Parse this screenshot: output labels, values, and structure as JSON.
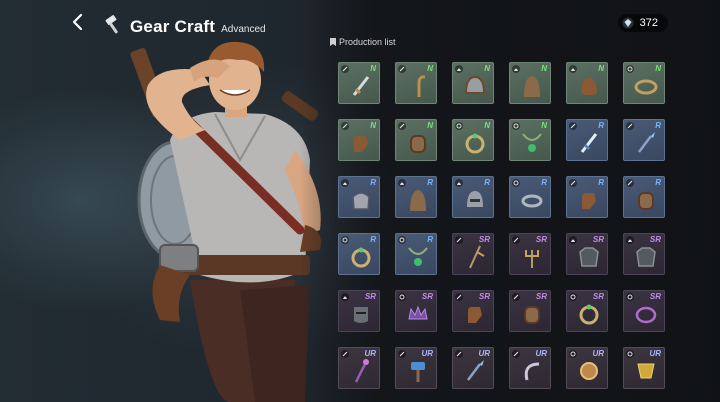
{
  "header": {
    "title": "Gear Craft",
    "subtitle": "Advanced",
    "back_icon": "back-arrow-icon",
    "title_icon": "hammer-icon"
  },
  "currency": {
    "icon": "gem-icon",
    "amount": "372"
  },
  "production": {
    "label": "Production list",
    "items": [
      {
        "rank": "N",
        "type": "weapon",
        "name": "sword"
      },
      {
        "rank": "N",
        "type": "weapon",
        "name": "hook"
      },
      {
        "rank": "N",
        "type": "helm",
        "name": "helmet"
      },
      {
        "rank": "N",
        "type": "helm",
        "name": "hood"
      },
      {
        "rank": "N",
        "type": "helm",
        "name": "cap"
      },
      {
        "rank": "N",
        "type": "ring",
        "name": "bracelet"
      },
      {
        "rank": "N",
        "type": "weapon",
        "name": "gauntlet"
      },
      {
        "rank": "N",
        "type": "weapon",
        "name": "bracer"
      },
      {
        "rank": "N",
        "type": "ring",
        "name": "ring"
      },
      {
        "rank": "N",
        "type": "ring",
        "name": "amulet"
      },
      {
        "rank": "R",
        "type": "weapon",
        "name": "dagger"
      },
      {
        "rank": "R",
        "type": "weapon",
        "name": "spear"
      },
      {
        "rank": "R",
        "type": "helm",
        "name": "pot"
      },
      {
        "rank": "R",
        "type": "helm",
        "name": "hood"
      },
      {
        "rank": "R",
        "type": "helm",
        "name": "visor"
      },
      {
        "rank": "R",
        "type": "ring",
        "name": "band"
      },
      {
        "rank": "R",
        "type": "weapon",
        "name": "gauntlet"
      },
      {
        "rank": "R",
        "type": "weapon",
        "name": "bracer"
      },
      {
        "rank": "R",
        "type": "ring",
        "name": "ring"
      },
      {
        "rank": "R",
        "type": "ring",
        "name": "amulet"
      },
      {
        "rank": "SR",
        "type": "weapon",
        "name": "pike"
      },
      {
        "rank": "SR",
        "type": "weapon",
        "name": "trident"
      },
      {
        "rank": "SR",
        "type": "helm",
        "name": "armor"
      },
      {
        "rank": "SR",
        "type": "helm",
        "name": "armor"
      },
      {
        "rank": "SR",
        "type": "helm",
        "name": "mask"
      },
      {
        "rank": "SR",
        "type": "ring",
        "name": "crown"
      },
      {
        "rank": "SR",
        "type": "weapon",
        "name": "gauntlet"
      },
      {
        "rank": "SR",
        "type": "weapon",
        "name": "bracer"
      },
      {
        "rank": "SR",
        "type": "ring",
        "name": "ring"
      },
      {
        "rank": "SR",
        "type": "ring",
        "name": "circlet"
      },
      {
        "rank": "UR",
        "type": "weapon",
        "name": "staff"
      },
      {
        "rank": "UR",
        "type": "weapon",
        "name": "hammer"
      },
      {
        "rank": "UR",
        "type": "weapon",
        "name": "spear"
      },
      {
        "rank": "UR",
        "type": "weapon",
        "name": "sickle"
      },
      {
        "rank": "UR",
        "type": "ring",
        "name": "orb"
      },
      {
        "rank": "UR",
        "type": "ring",
        "name": "locket"
      }
    ]
  },
  "colors": {
    "rank_N": "#7be07b",
    "rank_R": "#79b2ff",
    "rank_SR": "#c08ae8",
    "rank_UR": "#a9b6ff"
  }
}
